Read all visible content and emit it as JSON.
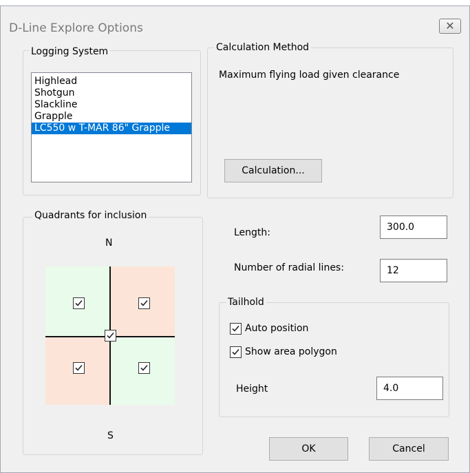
{
  "window": {
    "title": "D-Line Explore Options",
    "close_icon": "✕"
  },
  "logging_system": {
    "label": "Logging System",
    "items": [
      "Highlead",
      "Shotgun",
      "Slackline",
      "Grapple",
      "LC550 w T-MAR 86\" Grapple"
    ],
    "selected": "LC550 w T-MAR 86\" Grapple"
  },
  "calculation_method": {
    "label": "Calculation Method",
    "description": "Maximum flying load given clearance",
    "button_label": "Calculation..."
  },
  "quadrants": {
    "label": "Quadrants for inclusion",
    "north": "N",
    "south": "S",
    "nw_checked": true,
    "ne_checked": true,
    "sw_checked": true,
    "se_checked": true,
    "center_checked": true,
    "colors": {
      "green": "#e9fbea",
      "orange": "#fce5d8"
    }
  },
  "length": {
    "label": "Length:",
    "value": "300.0"
  },
  "radial_lines": {
    "label": "Number of radial lines:",
    "value": "12"
  },
  "tailhold": {
    "label": "Tailhold",
    "auto_position": {
      "label": "Auto position",
      "checked": true
    },
    "show_area_polygon": {
      "label": "Show area polygon",
      "checked": true
    },
    "height": {
      "label": "Height",
      "value": "4.0"
    }
  },
  "buttons": {
    "ok": "OK",
    "cancel": "Cancel"
  }
}
